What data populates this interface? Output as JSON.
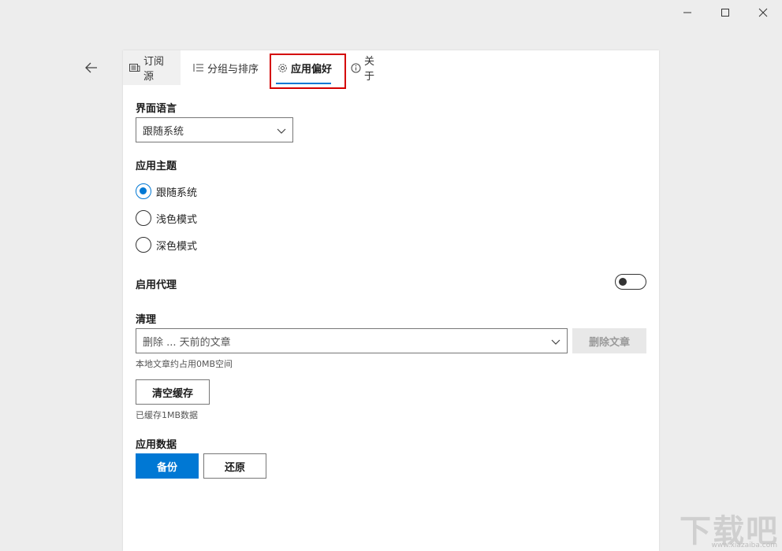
{
  "window": {
    "icons": [
      "minimize-icon",
      "maximize-icon",
      "close-icon"
    ]
  },
  "nav": {
    "back_icon": "arrow-left-icon"
  },
  "tabs": [
    {
      "label": "订阅源",
      "icon": "news-feed-icon"
    },
    {
      "label": "分组与排序",
      "icon": "list-icon"
    },
    {
      "label": "应用偏好",
      "icon": "gear-icon",
      "active": true
    },
    {
      "label": "关于",
      "icon": "info-icon"
    }
  ],
  "language": {
    "label": "界面语言",
    "selected": "跟随系统"
  },
  "theme": {
    "label": "应用主题",
    "options": [
      {
        "label": "跟随系统",
        "checked": true
      },
      {
        "label": "浅色模式",
        "checked": false
      },
      {
        "label": "深色模式",
        "checked": false
      }
    ]
  },
  "proxy": {
    "label": "启用代理",
    "enabled": false
  },
  "cleanup": {
    "label": "清理",
    "select_value": "删除 ... 天前的文章",
    "delete_button": "删除文章",
    "storage_hint": "本地文章约占用0MB空间",
    "clear_cache_button": "清空缓存",
    "cache_hint": "已缓存1MB数据"
  },
  "app_data": {
    "label": "应用数据",
    "backup_button": "备份",
    "restore_button": "还原"
  },
  "watermark": {
    "text": "下载吧",
    "url": "www.xiazaiba.com"
  },
  "colors": {
    "accent": "#0078d4",
    "highlight": "#d40000",
    "background": "#ededed"
  }
}
